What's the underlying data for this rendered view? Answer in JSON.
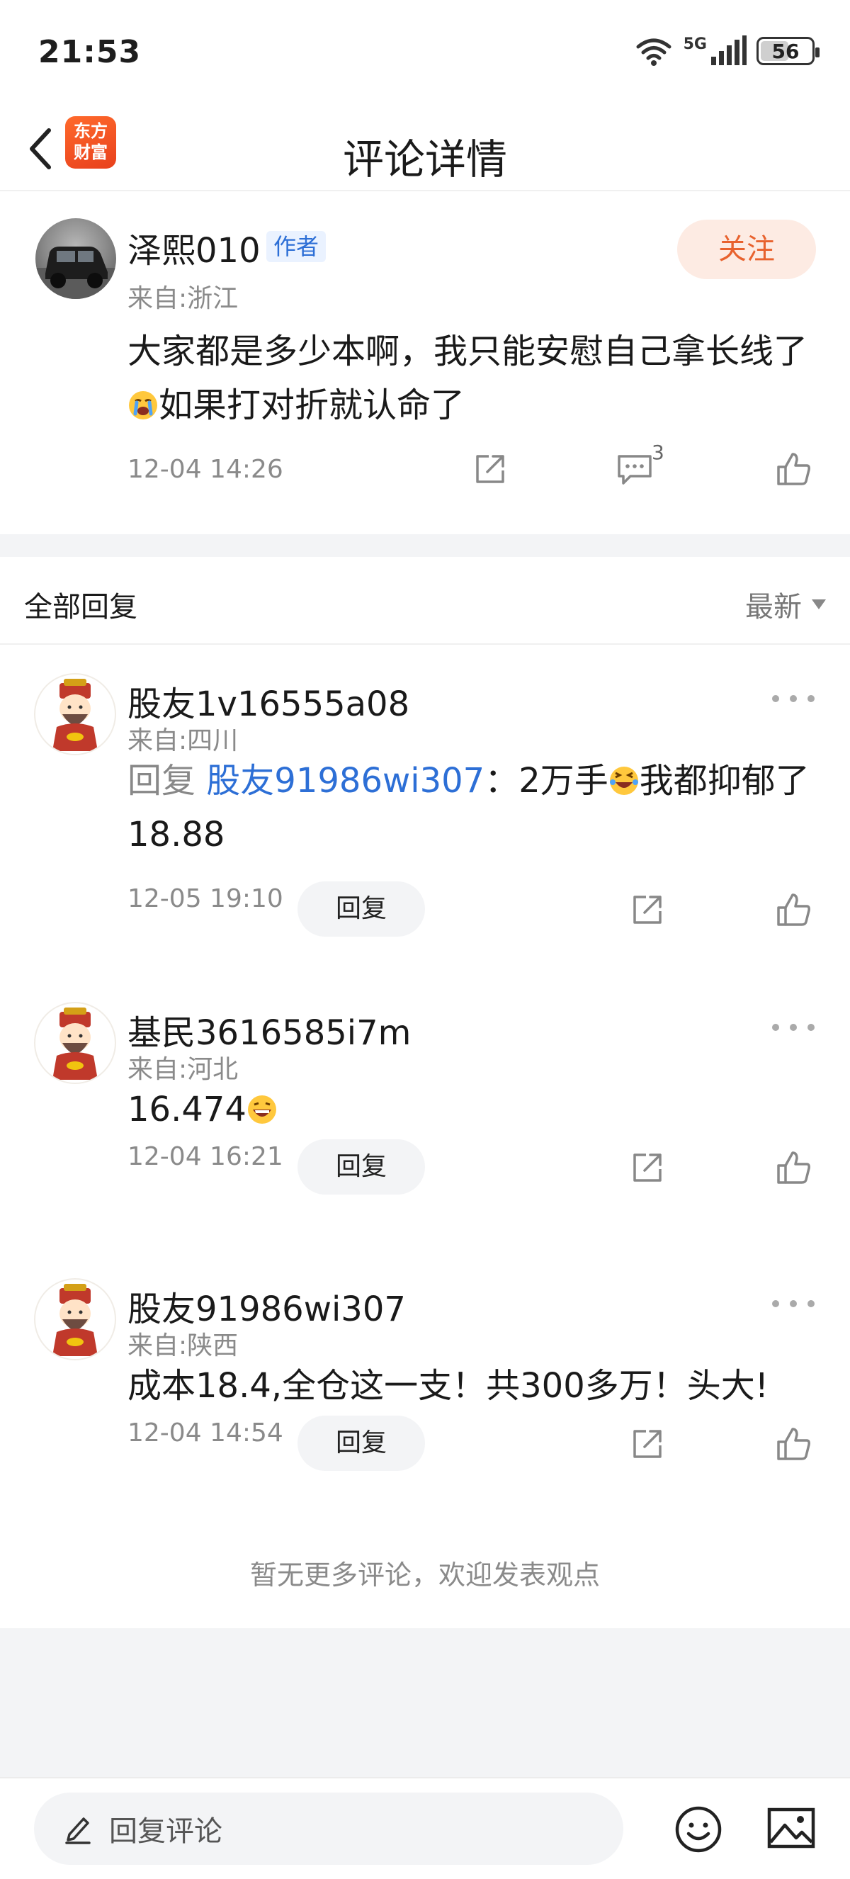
{
  "status_bar": {
    "time": "21:53",
    "network": "5G",
    "battery": "56",
    "battery_level": 0.56
  },
  "nav": {
    "title": "评论详情",
    "logo_line1": "东方",
    "logo_line2": "财富"
  },
  "main_comment": {
    "author": "泽熙010",
    "author_tag": "作者",
    "from": "来自:浙江",
    "follow_label": "关注",
    "text_part1": "大家都是多少本啊，我只能安慰自己拿长线了",
    "emoji_name": "crying-face",
    "text_part2": "如果打对折就认命了",
    "timestamp": "12-04 14:26",
    "comment_count": "3"
  },
  "replies_header": {
    "title": "全部回复",
    "sort_label": "最新"
  },
  "replies": [
    {
      "author": "股友1v16555a08",
      "from": "来自:四川",
      "reply_prefix": "回复",
      "mention": "股友91986wi307",
      "text_after_mention": "：2万手",
      "emoji_name": "laughing-tears",
      "text_after_emoji": "我都抑郁了",
      "text_line2": "18.88",
      "timestamp": "12-05 19:10",
      "reply_label": "回复"
    },
    {
      "author": "基民3616585i7m",
      "from": "来自:河北",
      "text": "16.474",
      "emoji_name": "grinning-face",
      "timestamp": "12-04 16:21",
      "reply_label": "回复"
    },
    {
      "author": "股友91986wi307",
      "from": "来自:陕西",
      "text": "成本18.4,全仓这一支！共300多万！头大!",
      "timestamp": "12-04 14:54",
      "reply_label": "回复"
    }
  ],
  "footer_note": "暂无更多评论，欢迎发表观点",
  "bottom_bar": {
    "input_placeholder": "回复评论"
  },
  "colors": {
    "accent_orange": "#e8622e",
    "link_blue": "#2d6fd6",
    "gray_bg": "#f3f4f6"
  }
}
